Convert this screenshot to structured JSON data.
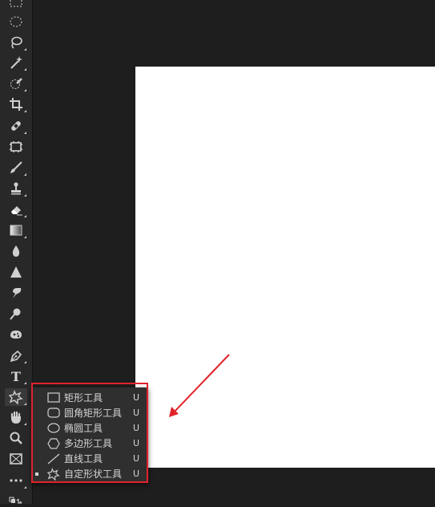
{
  "flyout_menu": {
    "items": [
      {
        "label": "矩形工具",
        "shortcut": "U",
        "icon": "rectangle-icon",
        "selected": false
      },
      {
        "label": "圆角矩形工具",
        "shortcut": "U",
        "icon": "rounded-rectangle-icon",
        "selected": false
      },
      {
        "label": "椭圆工具",
        "shortcut": "U",
        "icon": "ellipse-icon",
        "selected": false
      },
      {
        "label": "多边形工具",
        "shortcut": "U",
        "icon": "polygon-icon",
        "selected": false
      },
      {
        "label": "直线工具",
        "shortcut": "U",
        "icon": "line-icon",
        "selected": false
      },
      {
        "label": "自定形状工具",
        "shortcut": "U",
        "icon": "custom-shape-icon",
        "selected": true
      }
    ]
  },
  "toolbar": {
    "type_tool_label": "T",
    "tools": [
      "marquee",
      "elliptical-marquee",
      "lasso",
      "magic-wand",
      "quick-selection",
      "crop",
      "healing-brush",
      "frame",
      "brush",
      "clone-stamp",
      "eraser",
      "gradient",
      "blur",
      "sharpen",
      "smudge",
      "dodge",
      "sponge",
      "pen",
      "type",
      "custom-shape",
      "hand",
      "zoom",
      "frame-tool",
      "more"
    ]
  },
  "colors": {
    "toolbar_bg": "#282828",
    "canvas_bg": "#1e1e1e",
    "document_bg": "#ffffff",
    "annotation_red": "#e0232b"
  }
}
